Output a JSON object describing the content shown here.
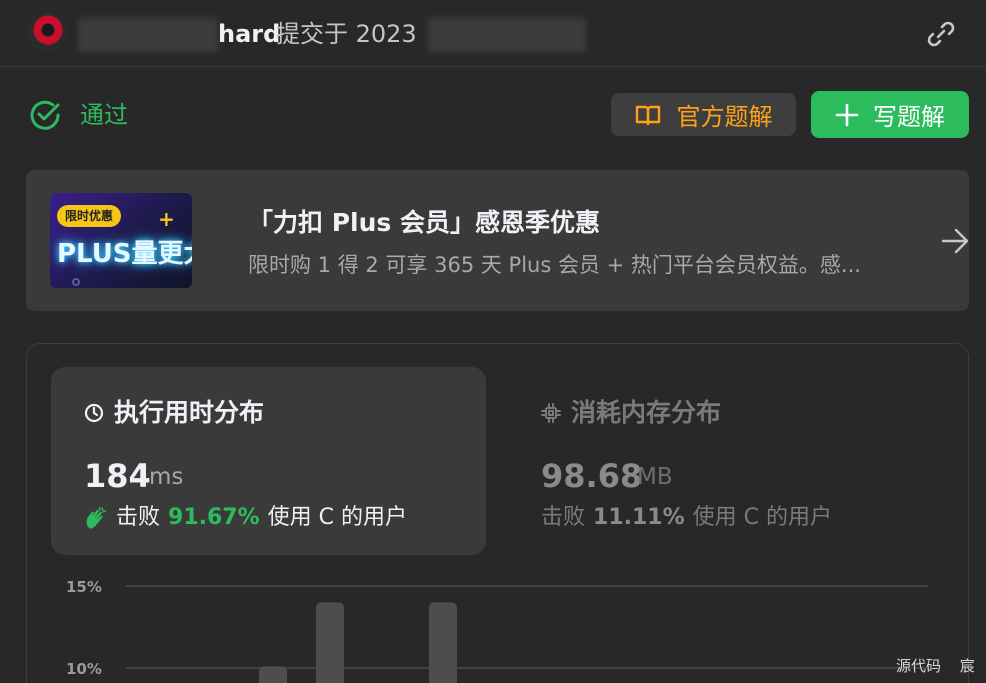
{
  "header": {
    "author_visible": "hard",
    "submitted_text": "提交于 2023",
    "icons": {
      "avatar": "user-avatar",
      "link": "link-icon"
    }
  },
  "status": {
    "label": "通过",
    "color": "#2cbb5d",
    "icon": "check-circle-icon"
  },
  "actions": {
    "official_solution": {
      "label": "官方题解",
      "icon": "book-open-icon",
      "color": "#ffa116"
    },
    "write_solution": {
      "label": "写题解",
      "icon": "plus-icon",
      "color": "#2cbb5d"
    }
  },
  "promo": {
    "badge": "限时优惠",
    "image_text": "PLUS量更大",
    "title": "「力扣 Plus 会员」感恩季优惠",
    "description": "限时购 1 得 2 可享 365 天 Plus 会员 + 热门平台会员权益。感...",
    "icon": "arrow-right-icon"
  },
  "runtime": {
    "title": "执行用时分布",
    "icon": "clock-icon",
    "value": "184",
    "unit": "ms",
    "beats_label": "击败",
    "beats_percent": "91.67%",
    "beats_suffix": "使用 C 的用户",
    "beats_icon": "clap-icon"
  },
  "memory": {
    "title": "消耗内存分布",
    "icon": "chip-icon",
    "value": "98.68",
    "unit": "MB",
    "beats_label": "击败",
    "beats_percent": "11.11%",
    "beats_suffix": "使用 C 的用户"
  },
  "chart_data": {
    "type": "bar",
    "title": "",
    "ylim": [
      7,
      15
    ],
    "y_ticks": [
      "15%",
      "10%"
    ],
    "y_tick_values": [
      15,
      10
    ],
    "grid": true,
    "bars": [
      {
        "x": 1,
        "value": 10.1
      },
      {
        "x": 2,
        "value": 14.0
      },
      {
        "x": 3,
        "value": 14.0
      }
    ]
  },
  "footer": {
    "source": "源代码",
    "author_initial": "宸"
  }
}
